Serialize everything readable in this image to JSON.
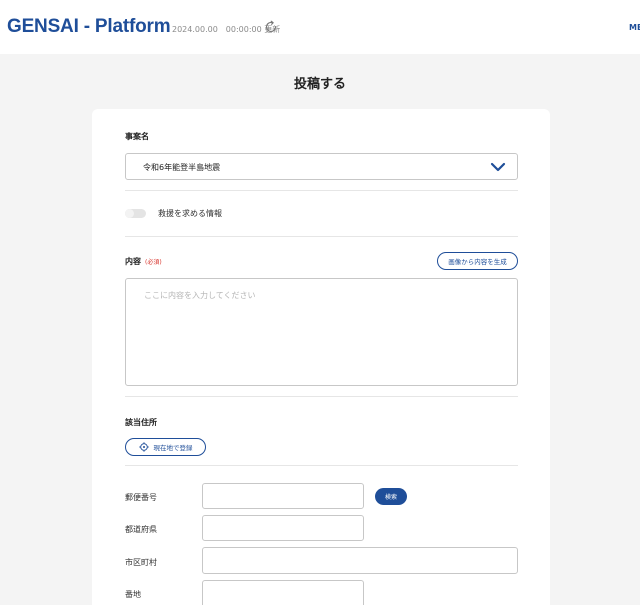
{
  "header": {
    "app_title": "GENSAI - Platform",
    "updated_text": "2024.00.00　00:00:00 更新",
    "menu_label": "MENU"
  },
  "page": {
    "title": "投稿する"
  },
  "form": {
    "incident": {
      "label": "事案名",
      "value": "令和6年能登半島地震"
    },
    "rescue_toggle": {
      "label": "救援を求める情報",
      "on": false
    },
    "content": {
      "label": "内容",
      "required": "(必須)",
      "generate_button": "画像から内容を生成",
      "placeholder": "ここに内容を入力してください"
    },
    "address": {
      "label": "該当住所",
      "current_location_button": "現在地で登録",
      "postal_code_label": "郵便番号",
      "search_button": "検索",
      "prefecture_label": "都道府県",
      "city_label": "市区町村",
      "street_label": "番地"
    }
  },
  "colors": {
    "brand": "#1f4e99",
    "required": "#d8362e"
  }
}
